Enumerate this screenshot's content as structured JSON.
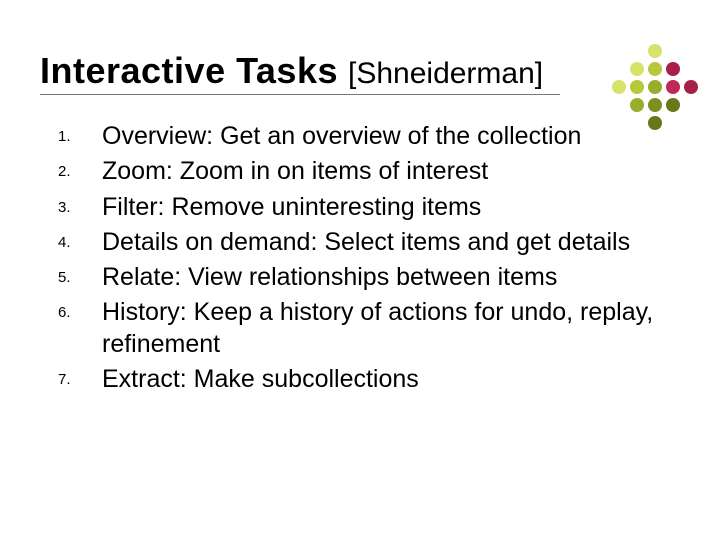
{
  "title": {
    "main": "Interactive Tasks",
    "sub": "[Shneiderman]"
  },
  "list": {
    "items": [
      {
        "num": "1.",
        "text": "Overview: Get an overview of the collection"
      },
      {
        "num": "2.",
        "text": "Zoom: Zoom in on items of interest"
      },
      {
        "num": "3.",
        "text": "Filter: Remove uninteresting items"
      },
      {
        "num": "4.",
        "text": "Details on demand: Select items and get details"
      },
      {
        "num": "5.",
        "text": "Relate: View relationships between items"
      },
      {
        "num": "6.",
        "text": "History: Keep a history of actions for undo, replay, refinement"
      },
      {
        "num": "7.",
        "text": "Extract: Make subcollections"
      }
    ]
  },
  "decor": {
    "dots": [
      [
        "",
        "",
        "#d6e26a",
        "",
        ""
      ],
      [
        "",
        "#d6e26a",
        "#b7c93a",
        "#a6204a",
        ""
      ],
      [
        "#d6e26a",
        "#b7c93a",
        "#9aad2a",
        "#c02858",
        "#a6204a"
      ],
      [
        "",
        "#9aad2a",
        "#7e8f1f",
        "#6a7618",
        ""
      ],
      [
        "",
        "",
        "#6a7618",
        "",
        ""
      ]
    ]
  }
}
